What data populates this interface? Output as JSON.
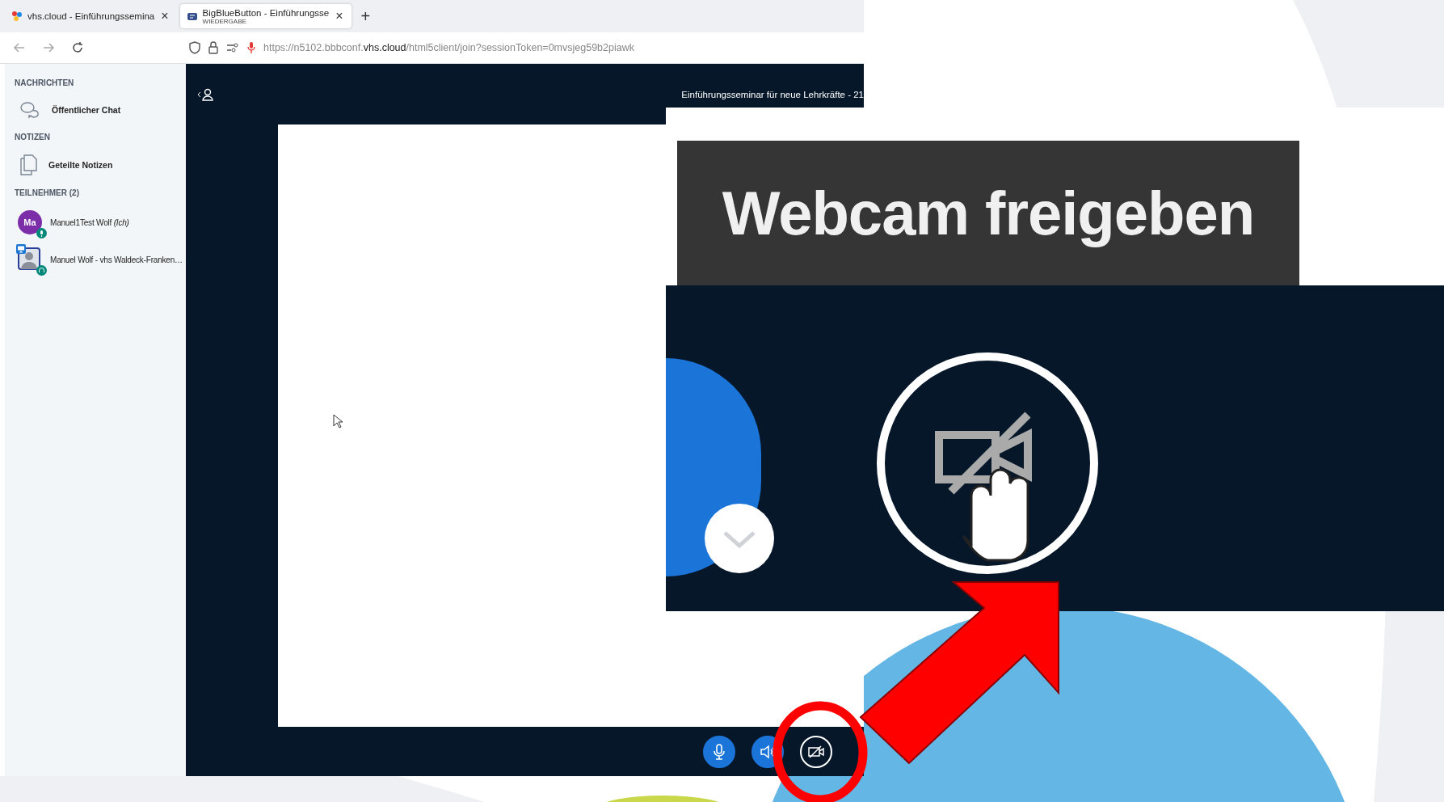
{
  "browser": {
    "tabs": [
      {
        "title": "vhs.cloud - Einführungssemina",
        "selected": false,
        "close": "×"
      },
      {
        "title": "BigBlueButton - Einführungsse",
        "subtitle": "WIEDERGABE",
        "selected": true,
        "close": "×"
      }
    ],
    "new_tab": "+",
    "url": {
      "prefix": "https://n5102.bbbconf.",
      "domain": "vhs.cloud",
      "suffix": "/html5client/join?sessionToken=0mvsjeg59b2piawk"
    }
  },
  "sidebar": {
    "sections": [
      {
        "heading": "NACHRICHTEN",
        "items": [
          {
            "kind": "chat",
            "label": "Öffentlicher Chat"
          }
        ]
      },
      {
        "heading": "NOTIZEN",
        "items": [
          {
            "kind": "notes",
            "label": "Geteilte Notizen"
          }
        ]
      }
    ],
    "participants": {
      "heading": "TEILNEHMER (2)",
      "users": [
        {
          "kind": "initials",
          "name": "Manuel1Test Wolf *(Ich)*",
          "initials": "Ma",
          "color": "#7b2ea8",
          "listen_only": false,
          "presenter": false
        },
        {
          "kind": "photo",
          "name": "Manuel Wolf - vhs Waldeck-Franken…",
          "listen_only": true,
          "presenter": true
        }
      ]
    }
  },
  "meeting": {
    "title": "Einführungsseminar für neue Lehrkräfte - 21"
  },
  "controls": [
    {
      "kind": "mic",
      "active": true
    },
    {
      "kind": "speaker",
      "active": true
    },
    {
      "kind": "camera",
      "active": false
    }
  ],
  "zoom_inset": {
    "tooltip": "Webcam freigeben"
  }
}
